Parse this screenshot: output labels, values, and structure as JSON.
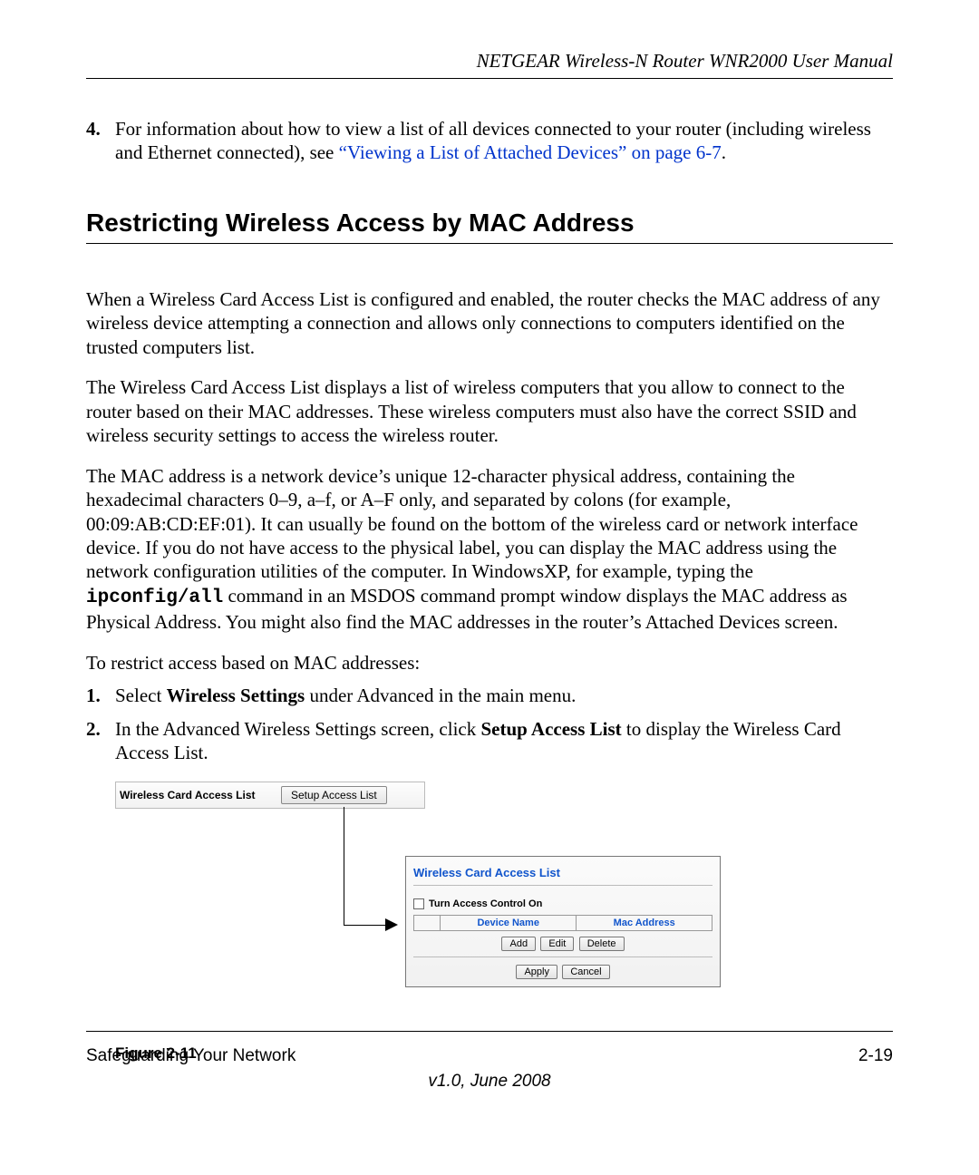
{
  "header": {
    "running": "NETGEAR Wireless-N Router WNR2000 User Manual"
  },
  "step4": {
    "num": "4.",
    "pre": "For information about how to view a list of all devices connected to your router (including wireless and Ethernet connected), see ",
    "link": "“Viewing a List of Attached Devices” on page 6-7",
    "post": "."
  },
  "section_title": "Restricting Wireless Access by MAC Address",
  "p1": "When a Wireless Card Access List is configured and enabled, the router checks the MAC address of any wireless device attempting a connection and allows only connections to computers identified on the trusted computers list.",
  "p2": "The Wireless Card Access List displays a list of wireless computers that you allow to connect to the router based on their MAC addresses. These wireless computers must also have the correct SSID and wireless security settings to access the wireless router.",
  "p3_pre": "The MAC address is a network device’s unique 12-character physical address, containing the hexadecimal characters 0–9, a–f, or A–F only, and separated by colons (for example, 00:09:AB:CD:EF:01). It can usually be found on the bottom of the wireless card or network interface device. If you do not have access to the physical label, you can display the MAC address using the network configuration utilities of the computer. In WindowsXP, for example, typing the ",
  "p3_cmd": "ipconfig/all",
  "p3_post": " command in an MSDOS command prompt window displays the MAC address as Physical Address. You might also find the MAC addresses in the router’s Attached Devices screen.",
  "p4": "To restrict access based on MAC addresses:",
  "steps": [
    {
      "num": "1.",
      "pre": "Select ",
      "bold": "Wireless Settings",
      "post": " under Advanced in the main menu."
    },
    {
      "num": "2.",
      "pre": "In the Advanced Wireless Settings screen, click ",
      "bold": "Setup Access List",
      "post": " to display the Wireless Card Access List."
    }
  ],
  "figure": {
    "top_label": "Wireless Card Access List",
    "top_button": "Setup Access List",
    "panel_title": "Wireless Card Access List",
    "checkbox_label": "Turn Access Control On",
    "col1": "Device Name",
    "col2": "Mac Address",
    "btn_add": "Add",
    "btn_edit": "Edit",
    "btn_delete": "Delete",
    "btn_apply": "Apply",
    "btn_cancel": "Cancel",
    "caption": "Figure 2-11"
  },
  "footer": {
    "left": "Safeguarding Your Network",
    "right": "2-19",
    "version": "v1.0, June 2008"
  }
}
